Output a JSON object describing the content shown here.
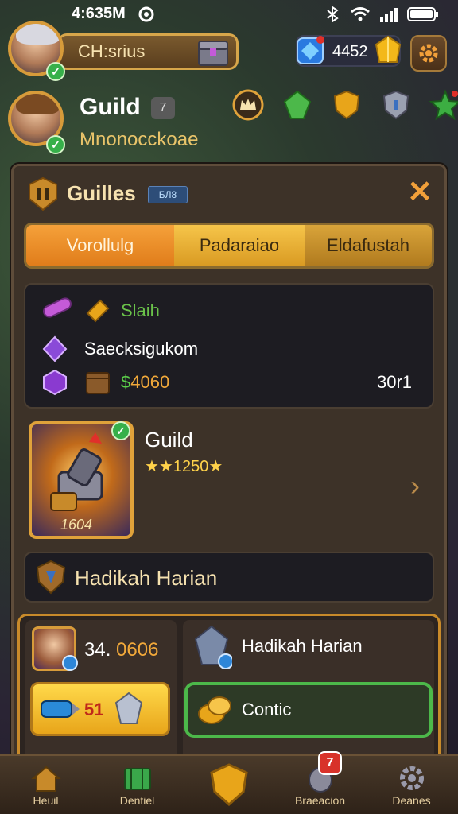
{
  "status_bar": {
    "time": "4:635M"
  },
  "player": {
    "name": "CH:srius"
  },
  "currency": {
    "gems": "4452"
  },
  "guild_header": {
    "title": "Guild",
    "badge": "7",
    "subtitle": "Mnonocckoae"
  },
  "panel": {
    "title": "Guilles",
    "tag": "БЛ8",
    "tabs": [
      {
        "label": "Vorollulg",
        "active": true
      },
      {
        "label": "Padaraiao",
        "active": false
      },
      {
        "label": "Eldafustah",
        "active": false
      }
    ]
  },
  "info": {
    "row1_label": "Slaih",
    "row2_label": "Saecksigukom",
    "row3_currency": "$",
    "row3_value": "4060",
    "row3_right": "30r1"
  },
  "guild_item": {
    "name": "Guild",
    "rating_text": "1250",
    "count": "1604"
  },
  "daily": {
    "label": "Hadikah Harian"
  },
  "sub_panel": {
    "left_value_prefix": "34.",
    "left_value_accent": "0606",
    "button_value": "51",
    "right_label": "Hadikah Harian",
    "green_button_label": "Contic"
  },
  "bottom_nav": [
    {
      "label": "Heuil"
    },
    {
      "label": "Dentiel"
    },
    {
      "label": ""
    },
    {
      "label": "Braeacion",
      "badge": "7"
    },
    {
      "label": "Deanes"
    }
  ],
  "colors": {
    "accent_orange": "#e07c1a",
    "accent_gold": "#d79b3a",
    "accent_green": "#4cb84a"
  }
}
